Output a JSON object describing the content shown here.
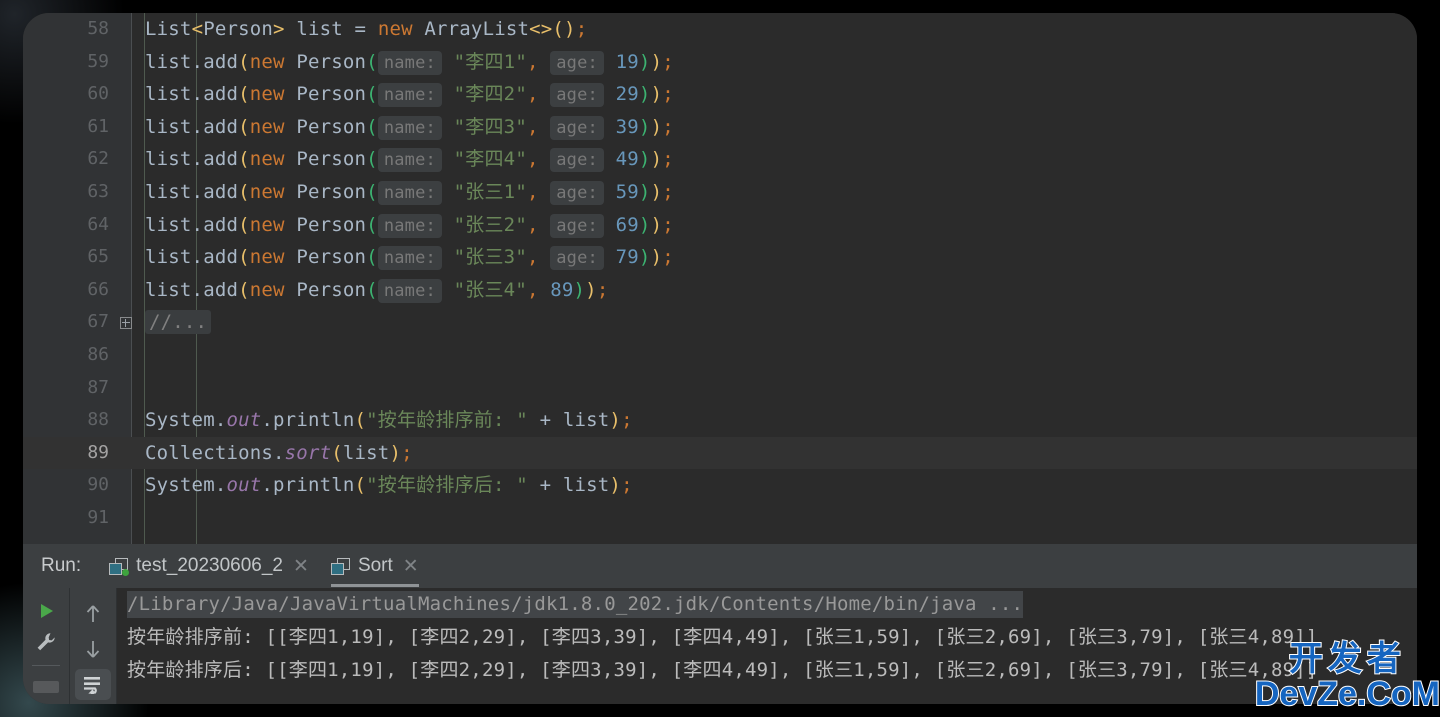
{
  "editor": {
    "lines": [
      {
        "num": "58",
        "active": false,
        "tokens": [
          {
            "t": "List",
            "c": "plain"
          },
          {
            "t": "<",
            "c": "angle"
          },
          {
            "t": "Person",
            "c": "plain"
          },
          {
            "t": ">",
            "c": "angle"
          },
          {
            "t": " list ",
            "c": "plain"
          },
          {
            "t": "= ",
            "c": "plain"
          },
          {
            "t": "new",
            "c": "kw"
          },
          {
            "t": " ArrayList",
            "c": "plain"
          },
          {
            "t": "<>",
            "c": "angle"
          },
          {
            "t": "()",
            "c": "paren-y"
          },
          {
            "t": ";",
            "c": "sem"
          }
        ]
      },
      {
        "num": "59",
        "active": false,
        "tokens": [
          {
            "t": "list.add",
            "c": "plain"
          },
          {
            "t": "(",
            "c": "paren-y"
          },
          {
            "t": "new",
            "c": "kw"
          },
          {
            "t": " Person",
            "c": "plain"
          },
          {
            "t": "(",
            "c": "paren-g"
          },
          {
            "t": "name:",
            "c": "hint"
          },
          {
            "t": " ",
            "c": "plain"
          },
          {
            "t": "\"李四1\"",
            "c": "str"
          },
          {
            "t": ",",
            "c": "sem"
          },
          {
            "t": " ",
            "c": "plain"
          },
          {
            "t": "age:",
            "c": "hint"
          },
          {
            "t": " ",
            "c": "plain"
          },
          {
            "t": "19",
            "c": "num"
          },
          {
            "t": ")",
            "c": "paren-g"
          },
          {
            "t": ")",
            "c": "paren-y"
          },
          {
            "t": ";",
            "c": "sem"
          }
        ]
      },
      {
        "num": "60",
        "active": false,
        "tokens": [
          {
            "t": "list.add",
            "c": "plain"
          },
          {
            "t": "(",
            "c": "paren-y"
          },
          {
            "t": "new",
            "c": "kw"
          },
          {
            "t": " Person",
            "c": "plain"
          },
          {
            "t": "(",
            "c": "paren-g"
          },
          {
            "t": "name:",
            "c": "hint"
          },
          {
            "t": " ",
            "c": "plain"
          },
          {
            "t": "\"李四2\"",
            "c": "str"
          },
          {
            "t": ",",
            "c": "sem"
          },
          {
            "t": " ",
            "c": "plain"
          },
          {
            "t": "age:",
            "c": "hint"
          },
          {
            "t": " ",
            "c": "plain"
          },
          {
            "t": "29",
            "c": "num"
          },
          {
            "t": ")",
            "c": "paren-g"
          },
          {
            "t": ")",
            "c": "paren-y"
          },
          {
            "t": ";",
            "c": "sem"
          }
        ]
      },
      {
        "num": "61",
        "active": false,
        "tokens": [
          {
            "t": "list.add",
            "c": "plain"
          },
          {
            "t": "(",
            "c": "paren-y"
          },
          {
            "t": "new",
            "c": "kw"
          },
          {
            "t": " Person",
            "c": "plain"
          },
          {
            "t": "(",
            "c": "paren-g"
          },
          {
            "t": "name:",
            "c": "hint"
          },
          {
            "t": " ",
            "c": "plain"
          },
          {
            "t": "\"李四3\"",
            "c": "str"
          },
          {
            "t": ",",
            "c": "sem"
          },
          {
            "t": " ",
            "c": "plain"
          },
          {
            "t": "age:",
            "c": "hint"
          },
          {
            "t": " ",
            "c": "plain"
          },
          {
            "t": "39",
            "c": "num"
          },
          {
            "t": ")",
            "c": "paren-g"
          },
          {
            "t": ")",
            "c": "paren-y"
          },
          {
            "t": ";",
            "c": "sem"
          }
        ]
      },
      {
        "num": "62",
        "active": false,
        "tokens": [
          {
            "t": "list.add",
            "c": "plain"
          },
          {
            "t": "(",
            "c": "paren-y"
          },
          {
            "t": "new",
            "c": "kw"
          },
          {
            "t": " Person",
            "c": "plain"
          },
          {
            "t": "(",
            "c": "paren-g"
          },
          {
            "t": "name:",
            "c": "hint"
          },
          {
            "t": " ",
            "c": "plain"
          },
          {
            "t": "\"李四4\"",
            "c": "str"
          },
          {
            "t": ",",
            "c": "sem"
          },
          {
            "t": " ",
            "c": "plain"
          },
          {
            "t": "age:",
            "c": "hint"
          },
          {
            "t": " ",
            "c": "plain"
          },
          {
            "t": "49",
            "c": "num"
          },
          {
            "t": ")",
            "c": "paren-g"
          },
          {
            "t": ")",
            "c": "paren-y"
          },
          {
            "t": ";",
            "c": "sem"
          }
        ]
      },
      {
        "num": "63",
        "active": false,
        "tokens": [
          {
            "t": "list.add",
            "c": "plain"
          },
          {
            "t": "(",
            "c": "paren-y"
          },
          {
            "t": "new",
            "c": "kw"
          },
          {
            "t": " Person",
            "c": "plain"
          },
          {
            "t": "(",
            "c": "paren-g"
          },
          {
            "t": "name:",
            "c": "hint"
          },
          {
            "t": " ",
            "c": "plain"
          },
          {
            "t": "\"张三1\"",
            "c": "str"
          },
          {
            "t": ",",
            "c": "sem"
          },
          {
            "t": " ",
            "c": "plain"
          },
          {
            "t": "age:",
            "c": "hint"
          },
          {
            "t": " ",
            "c": "plain"
          },
          {
            "t": "59",
            "c": "num"
          },
          {
            "t": ")",
            "c": "paren-g"
          },
          {
            "t": ")",
            "c": "paren-y"
          },
          {
            "t": ";",
            "c": "sem"
          }
        ]
      },
      {
        "num": "64",
        "active": false,
        "tokens": [
          {
            "t": "list.add",
            "c": "plain"
          },
          {
            "t": "(",
            "c": "paren-y"
          },
          {
            "t": "new",
            "c": "kw"
          },
          {
            "t": " Person",
            "c": "plain"
          },
          {
            "t": "(",
            "c": "paren-g"
          },
          {
            "t": "name:",
            "c": "hint"
          },
          {
            "t": " ",
            "c": "plain"
          },
          {
            "t": "\"张三2\"",
            "c": "str"
          },
          {
            "t": ",",
            "c": "sem"
          },
          {
            "t": " ",
            "c": "plain"
          },
          {
            "t": "age:",
            "c": "hint"
          },
          {
            "t": " ",
            "c": "plain"
          },
          {
            "t": "69",
            "c": "num"
          },
          {
            "t": ")",
            "c": "paren-g"
          },
          {
            "t": ")",
            "c": "paren-y"
          },
          {
            "t": ";",
            "c": "sem"
          }
        ]
      },
      {
        "num": "65",
        "active": false,
        "tokens": [
          {
            "t": "list.add",
            "c": "plain"
          },
          {
            "t": "(",
            "c": "paren-y"
          },
          {
            "t": "new",
            "c": "kw"
          },
          {
            "t": " Person",
            "c": "plain"
          },
          {
            "t": "(",
            "c": "paren-g"
          },
          {
            "t": "name:",
            "c": "hint"
          },
          {
            "t": " ",
            "c": "plain"
          },
          {
            "t": "\"张三3\"",
            "c": "str"
          },
          {
            "t": ",",
            "c": "sem"
          },
          {
            "t": " ",
            "c": "plain"
          },
          {
            "t": "age:",
            "c": "hint"
          },
          {
            "t": " ",
            "c": "plain"
          },
          {
            "t": "79",
            "c": "num"
          },
          {
            "t": ")",
            "c": "paren-g"
          },
          {
            "t": ")",
            "c": "paren-y"
          },
          {
            "t": ";",
            "c": "sem"
          }
        ]
      },
      {
        "num": "66",
        "active": false,
        "tokens": [
          {
            "t": "list.add",
            "c": "plain"
          },
          {
            "t": "(",
            "c": "paren-y"
          },
          {
            "t": "new",
            "c": "kw"
          },
          {
            "t": " Person",
            "c": "plain"
          },
          {
            "t": "(",
            "c": "paren-g"
          },
          {
            "t": "name:",
            "c": "hint"
          },
          {
            "t": " ",
            "c": "plain"
          },
          {
            "t": "\"张三4\"",
            "c": "str"
          },
          {
            "t": ",",
            "c": "sem"
          },
          {
            "t": " ",
            "c": "plain"
          },
          {
            "t": "89",
            "c": "num"
          },
          {
            "t": ")",
            "c": "paren-g"
          },
          {
            "t": ")",
            "c": "paren-y"
          },
          {
            "t": ";",
            "c": "sem"
          }
        ]
      },
      {
        "num": "67",
        "active": false,
        "folded": true,
        "tokens": [
          {
            "t": "//...",
            "c": "fold"
          }
        ]
      },
      {
        "num": "86",
        "active": false,
        "tokens": []
      },
      {
        "num": "87",
        "active": false,
        "tokens": []
      },
      {
        "num": "88",
        "active": false,
        "tokens": [
          {
            "t": "System.",
            "c": "plain"
          },
          {
            "t": "out",
            "c": "field"
          },
          {
            "t": ".println",
            "c": "plain"
          },
          {
            "t": "(",
            "c": "paren-y"
          },
          {
            "t": "\"按年龄排序前: \"",
            "c": "str"
          },
          {
            "t": " + list",
            "c": "plain"
          },
          {
            "t": ")",
            "c": "paren-y"
          },
          {
            "t": ";",
            "c": "sem"
          }
        ]
      },
      {
        "num": "89",
        "active": true,
        "tokens": [
          {
            "t": "Collections.",
            "c": "plain"
          },
          {
            "t": "sort",
            "c": "field"
          },
          {
            "t": "(",
            "c": "paren-y"
          },
          {
            "t": "list",
            "c": "plain"
          },
          {
            "t": ")",
            "c": "paren-y"
          },
          {
            "t": ";",
            "c": "sem"
          }
        ]
      },
      {
        "num": "90",
        "active": false,
        "tokens": [
          {
            "t": "System.",
            "c": "plain"
          },
          {
            "t": "out",
            "c": "field"
          },
          {
            "t": ".println",
            "c": "plain"
          },
          {
            "t": "(",
            "c": "paren-y"
          },
          {
            "t": "\"按年龄排序后: \"",
            "c": "str"
          },
          {
            "t": " + list",
            "c": "plain"
          },
          {
            "t": ")",
            "c": "paren-y"
          },
          {
            "t": ";",
            "c": "sem"
          }
        ]
      },
      {
        "num": "91",
        "active": false,
        "tokens": []
      }
    ]
  },
  "run_panel": {
    "label": "Run:",
    "tabs": [
      {
        "name": "test_20230606_2",
        "selected": false,
        "running": true,
        "close": "✕"
      },
      {
        "name": "Sort",
        "selected": true,
        "running": false,
        "close": "✕"
      }
    ],
    "toolbar_left": [
      {
        "icon": "run-play-icon",
        "glyph": "▶"
      },
      {
        "icon": "wrench-settings-icon",
        "glyph": "🔧"
      }
    ],
    "toolbar_second": [
      {
        "icon": "arrow-up-icon",
        "glyph": "↑"
      },
      {
        "icon": "arrow-down-icon",
        "glyph": "↓"
      },
      {
        "icon": "soft-wrap-icon",
        "glyph": "↲"
      }
    ],
    "console": {
      "command": "/Library/Java/JavaVirtualMachines/jdk1.8.0_202.jdk/Contents/Home/bin/java ...",
      "output": [
        "按年龄排序前: [[李四1,19], [李四2,29], [李四3,39], [李四4,49], [张三1,59], [张三2,69], [张三3,79], [张三4,89]]",
        "按年龄排序后: [[李四1,19], [李四2,29], [李四3,39], [李四4,49], [张三1,59], [张三2,69], [张三3,79], [张三4,89]]"
      ]
    }
  },
  "watermark": {
    "line1": "开发者",
    "line2": "DevZe.CoM",
    "color": "#1565c0"
  },
  "theme": {
    "editor_bg": "#2b2b2b",
    "gutter_bg": "#313335",
    "panel_bg": "#3c3f41",
    "text": "#a9b7c6",
    "keyword": "#cc7832",
    "string": "#6a8759",
    "number": "#6897bb",
    "field": "#9876aa",
    "accent_yellow": "#e8bf6a",
    "accent_green": "#3cb371"
  }
}
